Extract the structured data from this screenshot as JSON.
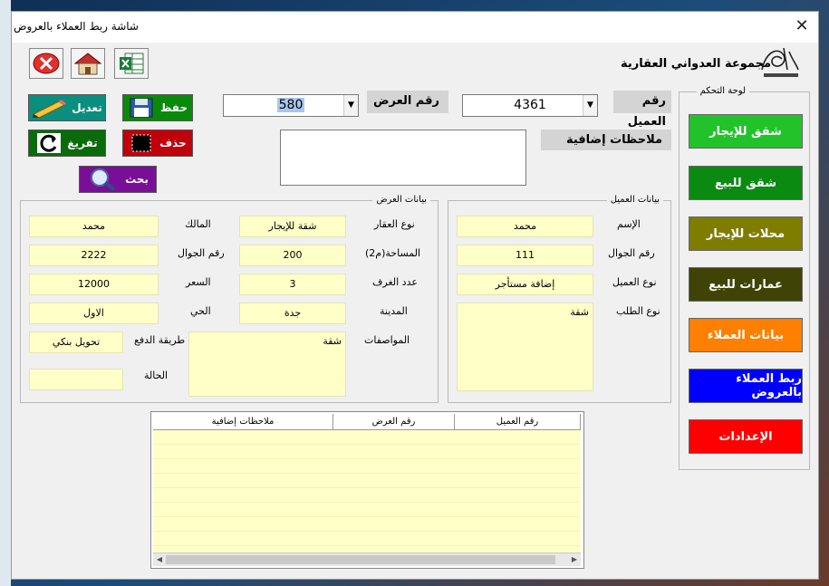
{
  "window": {
    "title": "شاشة ربط العملاء بالعروض",
    "close_glyph": "✕"
  },
  "company": {
    "name": "مجموعة العدواني العقارية"
  },
  "toolbar": {
    "edit": "تعديل",
    "save": "حفظ",
    "clear": "تفريغ",
    "delete": "حذف",
    "search": "بحث"
  },
  "client_number": {
    "label": "رقم العميل",
    "value": "4361"
  },
  "offer_number": {
    "label": "رقم العرض",
    "value": "580"
  },
  "notes": {
    "label": "ملاحظات إضافية",
    "value": ""
  },
  "client_group": {
    "caption": "بيانات العميل",
    "name_label": "الإسم",
    "name_value": "محمد",
    "mobile_label": "رقم الجوال",
    "mobile_value": "111",
    "type_label": "نوع العميل",
    "type_value": "إضافة مستأجر",
    "request_label": "نوع الطلب",
    "request_value": "شقة"
  },
  "offer_group": {
    "caption": "بيانات العرض",
    "property_type_label": "نوع العقار",
    "property_type_value": "شقة للإيجار",
    "area_label": "المساحة(م2)",
    "area_value": "200",
    "rooms_label": "عدد الغرف",
    "rooms_value": "3",
    "city_label": "المدينة",
    "city_value": "جدة",
    "specs_label": "المواصفات",
    "specs_value": "شقة",
    "owner_label": "المالك",
    "owner_value": "محمد",
    "owner_mobile_label": "رقم الجوال",
    "owner_mobile_value": "2222",
    "price_label": "السعر",
    "price_value": "12000",
    "district_label": "الحي",
    "district_value": "الاول",
    "payment_label": "طريقة الدفع",
    "payment_value": "تحويل بنكي",
    "status_label": "الحالة",
    "status_value": ""
  },
  "table": {
    "columns": [
      "ملاحظات إضافية",
      "رقم العرض",
      "رقم العميل"
    ],
    "rows": []
  },
  "control_panel": {
    "caption": "لوحة التحكم",
    "buttons": [
      {
        "label": "شقق للإيجار",
        "color": "#22c32a"
      },
      {
        "label": "شقق للبيع",
        "color": "#0b8a12"
      },
      {
        "label": "محلات للإيجار",
        "color": "#7f7d00"
      },
      {
        "label": "عمارات للبيع",
        "color": "#3f4306"
      },
      {
        "label": "بيانات العملاء",
        "color": "#ff7f00"
      },
      {
        "label": "ربط العملاء بالعروض",
        "color": "#0000ff"
      },
      {
        "label": "الإعدادات",
        "color": "#ff0000"
      }
    ]
  },
  "colors": {
    "edit": "#0a8f7e",
    "save": "#0a8a0a",
    "clear": "#0a6b0a",
    "delete": "#c0000a",
    "search": "#7a0f97",
    "field": "#ffffc8"
  }
}
